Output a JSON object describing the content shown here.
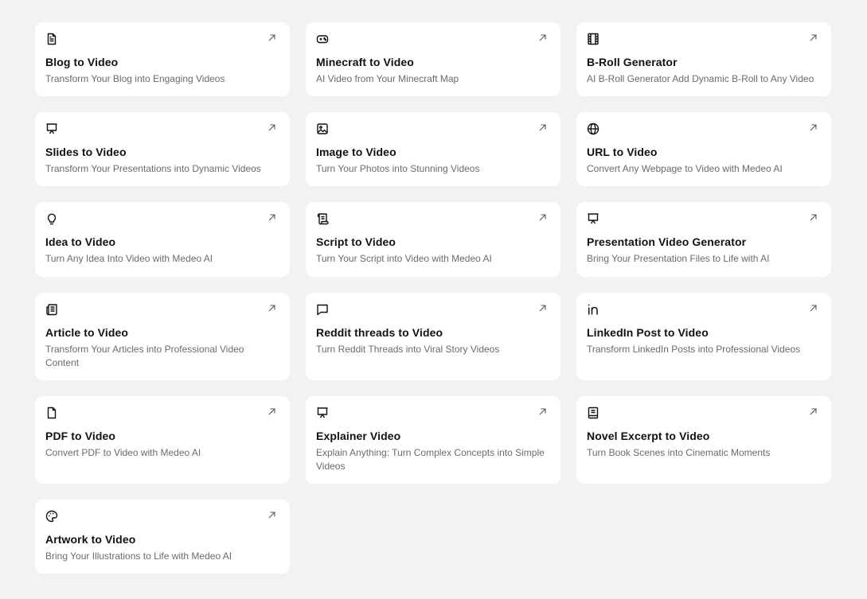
{
  "cards": [
    {
      "title": "Blog to Video",
      "description": "Transform Your Blog into Engaging Videos",
      "icon": "document-icon"
    },
    {
      "title": "Minecraft to Video",
      "description": "AI Video from Your Minecraft Map",
      "icon": "gamepad-icon"
    },
    {
      "title": "B-Roll Generator",
      "description": "AI B-Roll Generator Add Dynamic B-Roll to Any Video",
      "icon": "film-icon"
    },
    {
      "title": "Slides to Video",
      "description": "Transform Your Presentations into Dynamic Videos",
      "icon": "presentation-icon"
    },
    {
      "title": "Image to Video",
      "description": "Turn Your Photos into Stunning Videos",
      "icon": "image-icon"
    },
    {
      "title": "URL to Video",
      "description": "Convert Any Webpage to Video with Medeo AI",
      "icon": "globe-icon"
    },
    {
      "title": "Idea to Video",
      "description": "Turn Any Idea Into Video with Medeo AI",
      "icon": "lightbulb-icon"
    },
    {
      "title": "Script to Video",
      "description": "Turn Your Script into Video with Medeo AI",
      "icon": "scroll-icon"
    },
    {
      "title": "Presentation Video Generator",
      "description": "Bring Your Presentation Files to Life with AI",
      "icon": "presentation-icon"
    },
    {
      "title": "Article to Video",
      "description": "Transform Your Articles into Professional Video Content",
      "icon": "newspaper-icon"
    },
    {
      "title": "Reddit threads to Video",
      "description": "Turn Reddit Threads into Viral Story Videos",
      "icon": "chat-bubble-icon"
    },
    {
      "title": "LinkedIn Post to Video",
      "description": "Transform LinkedIn Posts into Professional Videos",
      "icon": "linkedin-icon"
    },
    {
      "title": "PDF to Video",
      "description": "Convert PDF to Video with Medeo AI",
      "icon": "file-icon"
    },
    {
      "title": "Explainer Video",
      "description": "Explain Anything: Turn Complex Concepts into Simple Videos",
      "icon": "presentation-icon"
    },
    {
      "title": "Novel Excerpt to Video",
      "description": "Turn Book Scenes into Cinematic Moments",
      "icon": "book-icon"
    },
    {
      "title": "Artwork to Video",
      "description": "Bring Your Illustrations to Life with Medeo AI",
      "icon": "palette-icon"
    }
  ]
}
